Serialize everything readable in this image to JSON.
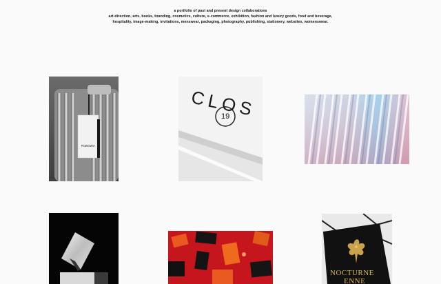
{
  "intro": {
    "line1": "a portfolio of past and present design collaborations",
    "line2": "art-direction, arts, books, branding, cosmetics, culture, e-commerce, exhibition, fashion and luxury goods, food and beverage,",
    "line3": "hospitality, image-making, invitations, menswear, packaging, photography, publishing, stationery, websites, womenswear."
  },
  "projects": [
    {
      "name": "luggage tag",
      "tag_text": "RIMOWA"
    },
    {
      "name": "clos19 logotype",
      "logo_text": "CLOS",
      "logo_number": "19"
    },
    {
      "name": "ribbed glass gradient"
    },
    {
      "name": "metal card"
    },
    {
      "name": "red packaging"
    },
    {
      "name": "nocturne box",
      "box_text_1": "NOCTURNE",
      "box_text_2": "ENNE"
    }
  ],
  "colors": {
    "background": "#fafafa",
    "text": "#111111",
    "accent_red": "#c4161c",
    "gold": "#c9a24a"
  }
}
